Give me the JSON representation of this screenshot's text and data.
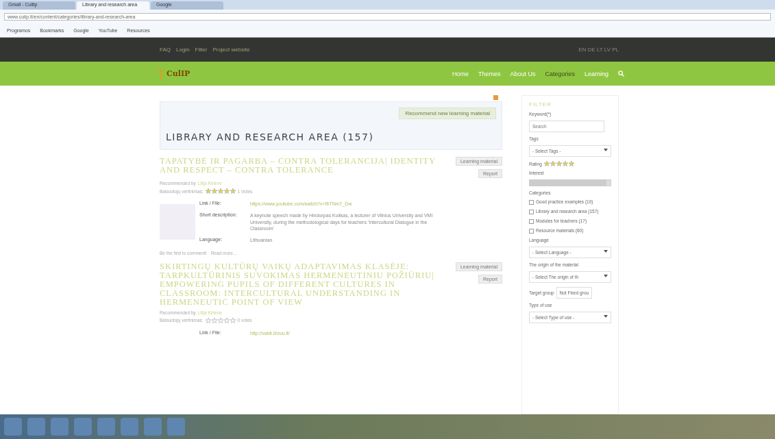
{
  "browser": {
    "tabs": [
      {
        "title": "Gmail - Cultip",
        "selected": false
      },
      {
        "title": "Library and research area",
        "selected": true
      },
      {
        "title": "Google",
        "selected": false
      }
    ],
    "url": "www.culip.lt/en/content/categories/library-and-research-area",
    "bookmarks": [
      "Programos",
      "Bookmarks",
      "Google",
      "YouTube",
      "Resources"
    ]
  },
  "top_bar": {
    "links": [
      "FAQ",
      "Login",
      "Filter",
      "Project website"
    ],
    "languages": "EN DE LT LV PL"
  },
  "nav": {
    "logo": "CulIP",
    "items": [
      {
        "label": "Home",
        "selected": false
      },
      {
        "label": "Themes",
        "selected": false
      },
      {
        "label": "About Us",
        "selected": false
      },
      {
        "label": "Categories",
        "selected": true
      },
      {
        "label": "Learning",
        "selected": false
      }
    ]
  },
  "main": {
    "recommend_button": "Recommend new learning material",
    "heading": "LIBRARY AND RESEARCH AREA (157)",
    "items": [
      {
        "title": "TAPATYBĖ IR PAGARBA – CONTRA TOLERANCIJA| IDENTITY AND RESPECT – CONTRA TOLERANCE",
        "recommended_label": "Recommended by",
        "recommended_by": "Lilija Kiriene",
        "rating_label": "Balsuotojų vertinimas:",
        "stars": 5,
        "votes": "1 Votes",
        "has_image": true,
        "fields": [
          {
            "label": "Link / File:",
            "value": "https://www.youtube.com/watch?v=fbTNm7_Dw",
            "kind": "link"
          },
          {
            "label": "Short description:",
            "value": "A keynote speech made by Hindurpas Kulikas, a lecturer of Vilnius University and VMI University, during the methodological days for teachers 'Intercultural Dialogue in the Classroom'",
            "kind": "text"
          },
          {
            "label": "Language:",
            "value": "Lithuanian",
            "kind": "text"
          }
        ],
        "footer": [
          "Be the first to comment!",
          "Read more..."
        ],
        "side_buttons": [
          "Learning material",
          "Report"
        ]
      },
      {
        "title": "SKIRTINGŲ KULTŪRŲ VAIKŲ ADAPTAVIMAS KLASĖJE: TARPKULTŪRINIS SUVOKIMAS HERMENEUTINIU POŽIŪRIU| EMPOWERING PUPILS OF DIFFERENT CULTURES IN CLASSROOM: INTERCULTURAL UNDERSTANDING IN HERMENEUTIC POINT OF VIEW",
        "recommended_label": "Recommended by",
        "recommended_by": "Lilija Kiriene",
        "rating_label": "Balsuotojų vertinimas:",
        "stars": 0,
        "votes": "0 votes",
        "has_image": false,
        "fields": [
          {
            "label": "Link / File:",
            "value": "http://valdi.lt/zuu.lt/",
            "kind": "link"
          }
        ],
        "side_buttons": [
          "Learning material",
          "Report"
        ]
      }
    ]
  },
  "filter": {
    "title": "FILTER",
    "keyword_label": "Keyword(*)",
    "keyword_placeholder": "Search",
    "tags_label": "Tags",
    "tags_value": "- Select Tags -",
    "rating_label": "Rating",
    "stars": 5,
    "interest_label": "Interest",
    "level": 0.95,
    "categories_label": "Categories",
    "categories": [
      {
        "label": "Good practice examples (10)",
        "checked": false
      },
      {
        "label": "Library and research area (157)",
        "checked": false
      },
      {
        "label": "Modules for teachers (17)",
        "checked": false
      },
      {
        "label": "Resource materials (60)",
        "checked": false
      }
    ],
    "language_label": "Language",
    "language_value": "- Select Language -",
    "origin_label": "The origin of the material",
    "origin_value": "- Select The origin of th",
    "target_label": "Target group",
    "target_value": "Not Fixed grou",
    "use_label": "Type of use",
    "use_value": "- Select Type of use -"
  }
}
